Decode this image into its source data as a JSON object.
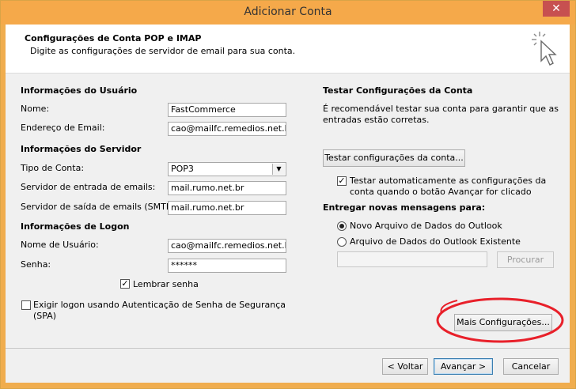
{
  "window": {
    "title": "Adicionar Conta",
    "close": "✕"
  },
  "header": {
    "title": "Configurações de Conta POP e IMAP",
    "subtitle": "Digite as configurações de servidor de email para sua conta."
  },
  "user_info": {
    "section": "Informações do Usuário",
    "name_label": "Nome:",
    "name_value": "FastCommerce",
    "email_label": "Endereço de Email:",
    "email_value": "cao@mailfc.remedios.net.br"
  },
  "server_info": {
    "section": "Informações do Servidor",
    "account_type_label": "Tipo de Conta:",
    "account_type_value": "POP3",
    "incoming_label": "Servidor de entrada de emails:",
    "incoming_value": "mail.rumo.net.br",
    "outgoing_label": "Servidor de saída de emails (SMTP):",
    "outgoing_value": "mail.rumo.net.br"
  },
  "logon_info": {
    "section": "Informações de Logon",
    "username_label": "Nome de Usuário:",
    "username_value": "cao@mailfc.remedios.net.br",
    "password_label": "Senha:",
    "password_value": "******",
    "remember_label": "Lembrar senha",
    "remember_checked": true,
    "spa_label_line1": "Exigir logon usando Autenticação de Senha de Segurança",
    "spa_label_line2": "(SPA)",
    "spa_checked": false
  },
  "test_settings": {
    "section": "Testar Configurações da Conta",
    "description_line1": "É recomendável testar sua conta para garantir que as",
    "description_line2": "entradas estão corretas.",
    "test_button": "Testar configurações da conta...",
    "auto_test_line1": "Testar automaticamente as configurações da",
    "auto_test_line2": "conta quando o botão Avançar for clicado",
    "auto_test_checked": true
  },
  "delivery": {
    "section": "Entregar novas mensagens para:",
    "option_new": "Novo Arquivo de Dados do Outlook",
    "option_existing": "Arquivo de Dados do Outlook Existente",
    "selected": "new",
    "path_value": "",
    "browse_button": "Procurar"
  },
  "more_settings_button": "Mais Configurações...",
  "footer": {
    "back": "< Voltar",
    "next": "Avançar >",
    "cancel": "Cancelar"
  },
  "annotation_color": "#e8202a"
}
